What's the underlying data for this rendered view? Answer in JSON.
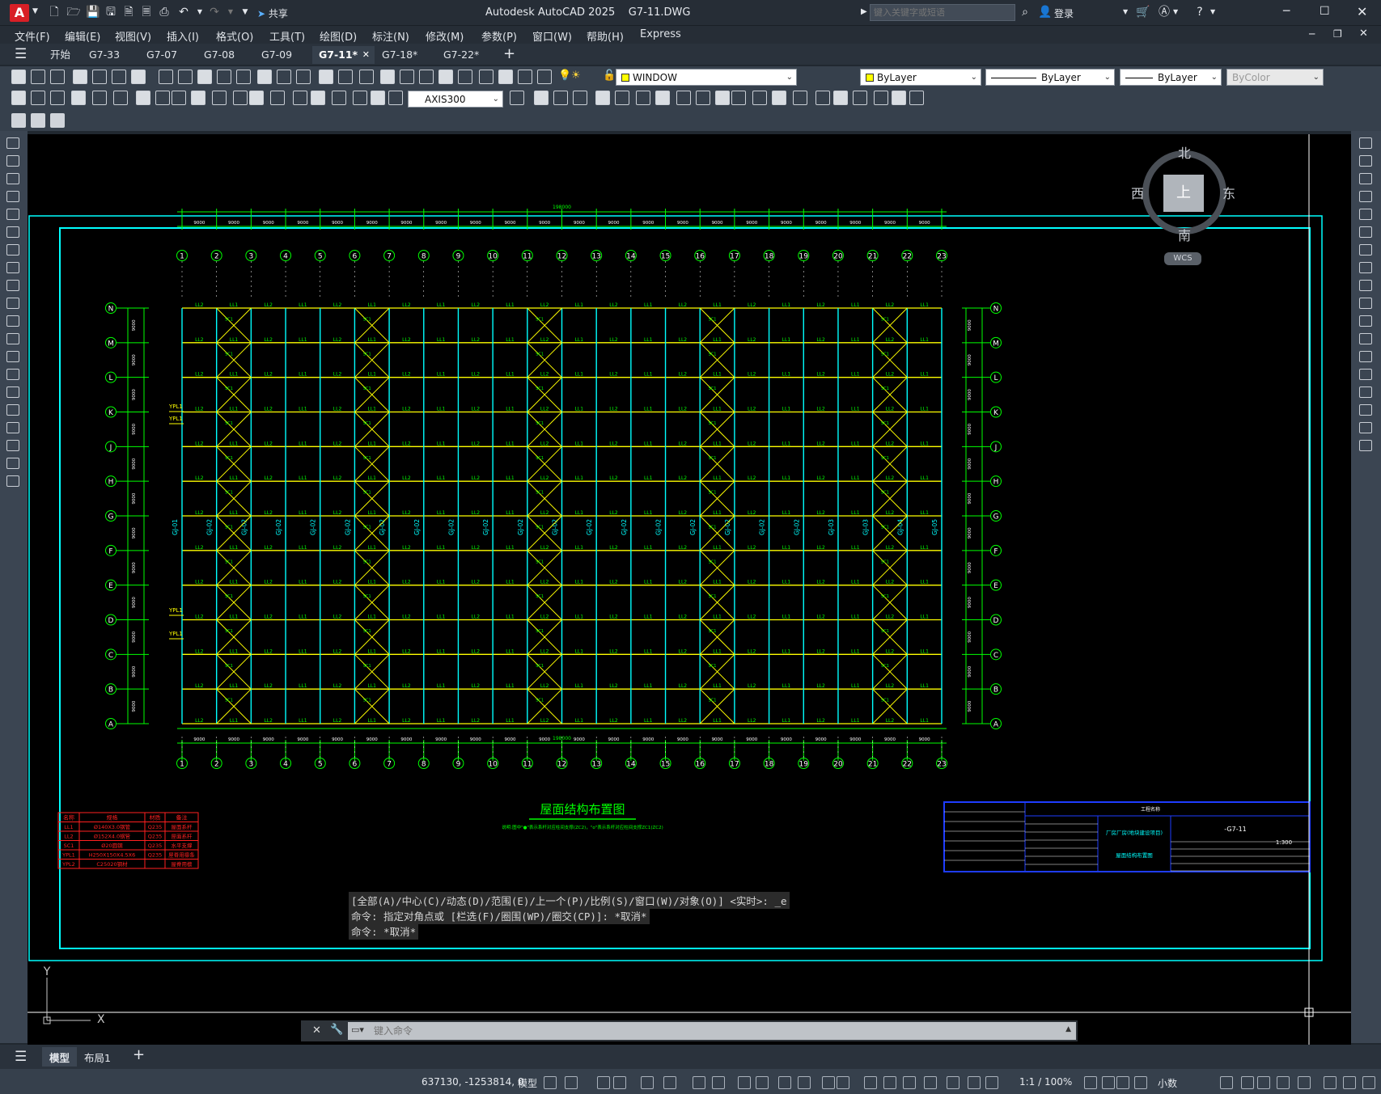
{
  "app": {
    "title": "Autodesk AutoCAD 2025",
    "filename": "G7-11.DWG",
    "logo": "A",
    "share_label": "共享",
    "search_placeholder": "键入关键字或短语",
    "login_label": "登录"
  },
  "menu": [
    "文件(F)",
    "编辑(E)",
    "视图(V)",
    "插入(I)",
    "格式(O)",
    "工具(T)",
    "绘图(D)",
    "标注(N)",
    "修改(M)",
    "参数(P)",
    "窗口(W)",
    "帮助(H)",
    "Express"
  ],
  "tabs": [
    {
      "label": "开始",
      "active": false
    },
    {
      "label": "G7-33",
      "active": false
    },
    {
      "label": "G7-07",
      "active": false
    },
    {
      "label": "G7-08",
      "active": false
    },
    {
      "label": "G7-09",
      "active": false
    },
    {
      "label": "G7-11*",
      "active": true
    },
    {
      "label": "G7-18*",
      "active": false
    },
    {
      "label": "G7-22*",
      "active": false
    }
  ],
  "toolbar": {
    "layer_value": "WINDOW",
    "color_value": "ByLayer",
    "linetype_value": "ByLayer",
    "lineweight_value": "ByLayer",
    "plotstyle_value": "ByColor",
    "dimstyle_value": "AXIS300"
  },
  "viewcube": {
    "north": "北",
    "south": "南",
    "east": "东",
    "west": "西",
    "top": "上",
    "wcs": "WCS"
  },
  "drawing": {
    "title": "屋面结构布置图",
    "note": "说明:图中\"●\"表示系杆对应柱间支撑(ZC2)，\"o\"表示系杆对应柱间支撑ZC1(ZC2)",
    "axes_top": [
      "1",
      "2",
      "3",
      "4",
      "5",
      "6",
      "7",
      "8",
      "9",
      "10",
      "11",
      "12",
      "13",
      "14",
      "15",
      "16",
      "17",
      "18",
      "19",
      "20",
      "21",
      "22",
      "23"
    ],
    "axes_side_left": [
      "N",
      "M",
      "L",
      "K",
      "J",
      "H",
      "G",
      "F",
      "E",
      "D",
      "C",
      "B",
      "A"
    ],
    "axes_side_right": [
      "N",
      "M",
      "L",
      "K",
      "J",
      "H",
      "G",
      "F",
      "E",
      "D",
      "C",
      "B",
      "A"
    ],
    "top_dim_total": "198000",
    "bottom_dim_total": "198000",
    "bay_dims": [
      "9000",
      "9000",
      "9000",
      "9000",
      "9000",
      "9000",
      "9000",
      "9000",
      "9000",
      "9000",
      "9000",
      "9000",
      "9000",
      "9000",
      "9000",
      "9000",
      "9000",
      "9000",
      "9000",
      "9000",
      "9000",
      "9000"
    ],
    "side_dim": "9000",
    "beam_labels": [
      "GJ-01",
      "GJ-02",
      "GJ-02",
      "GJ-02",
      "GJ-02",
      "GJ-02",
      "GJ-02",
      "GJ-02",
      "GJ-02",
      "GJ-02",
      "GJ-02",
      "GJ-02",
      "GJ-02",
      "GJ-02",
      "GJ-02",
      "GJ-02",
      "GJ-02",
      "GJ-02",
      "GJ-02",
      "GJ-03",
      "GJ-03",
      "GJ-04",
      "GJ-05"
    ],
    "members": [
      "LL1",
      "LL2",
      "SC1",
      "YPL1"
    ],
    "legend_header": [
      "名称",
      "规格",
      "材质",
      "备注"
    ],
    "legend_rows": [
      [
        "LL1",
        "Ø140X3.0钢管",
        "Q235",
        "屋面系杆"
      ],
      [
        "LL2",
        "Ø152X4.0钢管",
        "Q235",
        "屋面系杆"
      ],
      [
        "SC1",
        "Ø20圆钢",
        "Q235",
        "水平支撑"
      ],
      [
        "YPL1",
        "H250X150X4.5X6",
        "Q235",
        "屋脊用檩条"
      ],
      [
        "YPL2",
        "C25020钢材",
        "",
        "屋脊用檩"
      ]
    ],
    "titleblock": {
      "project_label": "工程名称",
      "project_name": "厂房厂房(地块建设项目)",
      "drawing_name": "屋面结构布置图",
      "drawing_no": "-G7-11",
      "scale": "1:300"
    }
  },
  "command": {
    "line1": "[全部(A)/中心(C)/动态(D)/范围(E)/上一个(P)/比例(S)/窗口(W)/对象(O)] <实时>: _e",
    "line2": "命令: 指定对角点或 [栏选(F)/圈围(WP)/圈交(CP)]: *取消*",
    "line3": "命令: *取消*",
    "placeholder": "键入命令"
  },
  "layout_tabs": [
    "模型",
    "布局1"
  ],
  "status": {
    "coords": "637130, -1253814, 0",
    "model": "模型",
    "scale": "1:1 / 100%",
    "units": "小数"
  },
  "colors": {
    "green": "#00ff00",
    "cyan": "#00ffff",
    "yellow": "#ffff00",
    "red": "#ff2020",
    "blue": "#1e3cff",
    "canvas": "#000000"
  }
}
